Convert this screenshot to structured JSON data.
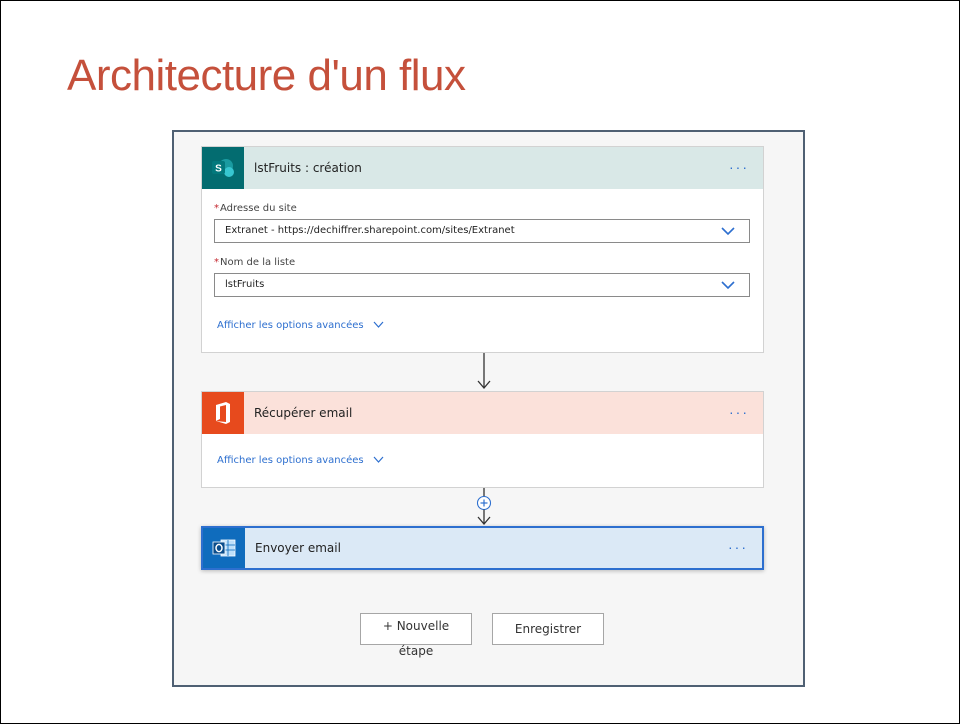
{
  "slide": {
    "title": "Architecture d'un flux"
  },
  "cards": {
    "trigger": {
      "title": "lstFruits : création",
      "icon": "sharepoint-icon",
      "menu": "···",
      "site_label": "Adresse du site",
      "site_value": "Extranet - https://dechiffrer.sharepoint.com/sites/Extranet",
      "list_label": "Nom de la liste",
      "list_value": "lstFruits",
      "required_mark": "*",
      "advanced_link": "Afficher les options avancées"
    },
    "get_email": {
      "title": "Récupérer email",
      "icon": "office-icon",
      "menu": "···",
      "advanced_link": "Afficher les options avancées"
    },
    "send_email": {
      "title": "Envoyer email",
      "icon": "outlook-icon",
      "menu": "···"
    }
  },
  "buttons": {
    "new_step": "+ Nouvelle étape",
    "save": "Enregistrer"
  },
  "colors": {
    "title": "#c5503b",
    "sharepoint_header": "#d9e8e7",
    "sharepoint_icon": "#036c70",
    "office_header": "#fbe1da",
    "office_icon": "#e74a1d",
    "outlook_header": "#dbe9f6",
    "outlook_icon": "#0f6cbd",
    "link": "#2d6fcf"
  }
}
